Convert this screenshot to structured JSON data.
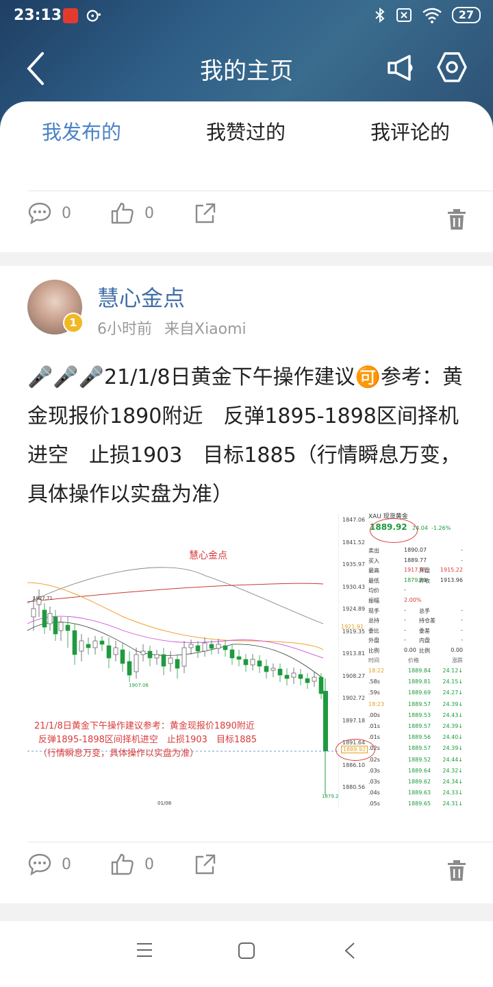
{
  "status": {
    "time": "23:13",
    "battery": "27"
  },
  "nav": {
    "title": "我的主页"
  },
  "tabs": [
    "我发布的",
    "我赞过的",
    "我评论的"
  ],
  "first_post": {
    "comments": "0",
    "likes": "0"
  },
  "post": {
    "author": "慧心金点",
    "time_ago": "6小时前",
    "source": "来自Xiaomi",
    "text": "🎤🎤🎤21/1/8日黄金下午操作建议🉑参考：黄金现报价1890附近　反弹1895-1898区间择机进空　止损1903　目标1885（行情瞬息万变，具体操作以实盘为准）",
    "comments": "0",
    "likes": "0"
  },
  "chart_image": {
    "watermark": "慧心金点",
    "overlay": [
      "21/1/8日黄金下午操作建议参考：黄金现报价1890附近",
      "反弹1895-1898区间择机进空　止损1903　目标1885",
      "（行情瞬息万变，具体操作以实盘为准）"
    ],
    "y_ticks": [
      "1847.06",
      "1841.52",
      "1935.97",
      "1930.43",
      "1924.89",
      "1919.35",
      "1913.81",
      "1908.27",
      "1902.72",
      "1897.18",
      "1891.64",
      "1886.10",
      "1880.56"
    ],
    "labels": {
      "high": "1927.71",
      "mid_low": "1907.06",
      "low": "1879.29",
      "ma": "1921.91",
      "current": "1889.92",
      "date": "01/08"
    },
    "quote": {
      "title": "XAU 现货黄金",
      "price": "1889.92",
      "change": "24.04",
      "change_pct": "-1.26%",
      "rows": [
        [
          "卖出",
          "1890.07",
          "",
          "-"
        ],
        [
          "买入",
          "1889.77",
          "",
          "-"
        ],
        [
          "最高",
          "1917.55",
          "开盘",
          "1915.22"
        ],
        [
          "最低",
          "1879.29",
          "昨收",
          "1913.96"
        ],
        [
          "均价",
          "-",
          "",
          ""
        ],
        [
          "振幅",
          "2.00%",
          "",
          ""
        ],
        [
          "现手",
          "-",
          "总手",
          "-"
        ],
        [
          "总持",
          "-",
          "持仓差",
          "-"
        ],
        [
          "委比",
          "-",
          "委差",
          "-"
        ],
        [
          "外盘",
          "-",
          "内盘",
          "-"
        ],
        [
          "比例",
          "0.00",
          "比例",
          "0.00"
        ]
      ],
      "ticks_header": [
        "时间",
        "价格",
        "涨跌"
      ],
      "ticks": [
        [
          "18:22",
          "1889.84",
          "24.12"
        ],
        [
          ".58s",
          "1889.81",
          "24.15"
        ],
        [
          ".59s",
          "1889.69",
          "24.27"
        ],
        [
          "18:23",
          "1889.57",
          "24.39"
        ],
        [
          ".00s",
          "1889.53",
          "24.43"
        ],
        [
          ".01s",
          "1889.57",
          "24.39"
        ],
        [
          ".01s",
          "1889.56",
          "24.40"
        ],
        [
          ".02s",
          "1889.57",
          "24.39"
        ],
        [
          ".02s",
          "1889.52",
          "24.44"
        ],
        [
          ".03s",
          "1889.64",
          "24.32"
        ],
        [
          ".03s",
          "1889.62",
          "24.34"
        ],
        [
          ".04s",
          "1889.63",
          "24.33"
        ],
        [
          ".05s",
          "1889.65",
          "24.31"
        ]
      ]
    }
  }
}
